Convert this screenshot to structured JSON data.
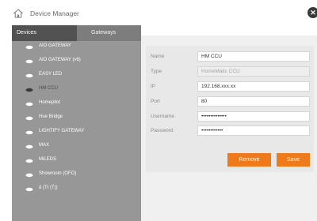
{
  "window": {
    "title": "Device Manager",
    "title_icon": "home-icon",
    "close_icon": "close-icon"
  },
  "tabs": [
    {
      "label": "Devices",
      "active": true
    },
    {
      "label": "Gateways",
      "active": false
    }
  ],
  "devices": [
    {
      "label": "AIO GATEWAY",
      "icon": "device-icon",
      "selected": false
    },
    {
      "label": "AIO GATEWAY (v6)",
      "icon": "device-icon",
      "selected": false
    },
    {
      "label": "EASY LED",
      "icon": "device-icon",
      "selected": false
    },
    {
      "label": "HM CCU",
      "icon": "device-icon",
      "selected": true
    },
    {
      "label": "Homepilot",
      "icon": "device-icon",
      "selected": false
    },
    {
      "label": "Hue Bridge",
      "icon": "device-icon",
      "selected": false
    },
    {
      "label": "LIGHTIFY GATEWAY",
      "icon": "device-icon",
      "selected": false
    },
    {
      "label": "MAX",
      "icon": "device-icon",
      "selected": false
    },
    {
      "label": "MiLEDS",
      "icon": "device-icon",
      "selected": false
    },
    {
      "label": "Showroom (OFO)",
      "icon": "device-icon",
      "selected": false
    },
    {
      "label": "d (TI (T))",
      "icon": "device-icon",
      "selected": false
    }
  ],
  "form": {
    "name_label": "Name",
    "name_value": "HM CCU",
    "type_label": "Type",
    "type_value": "HomeMatic CCU",
    "ip_label": "IP",
    "ip_value": "192.168.xxx.xx",
    "port_label": "Port",
    "port_value": "80",
    "username_label": "Username",
    "username_value": "••••••••••••••",
    "password_label": "Password",
    "password_value": "••••••••••••"
  },
  "buttons": {
    "remove_label": "Remove",
    "save_label": "Save"
  },
  "colors": {
    "accent": "#ee7a1c",
    "sidebar_bg": "#979797",
    "tab_active_bg": "#525252",
    "tab_bar_bg": "#7d7d7d"
  }
}
